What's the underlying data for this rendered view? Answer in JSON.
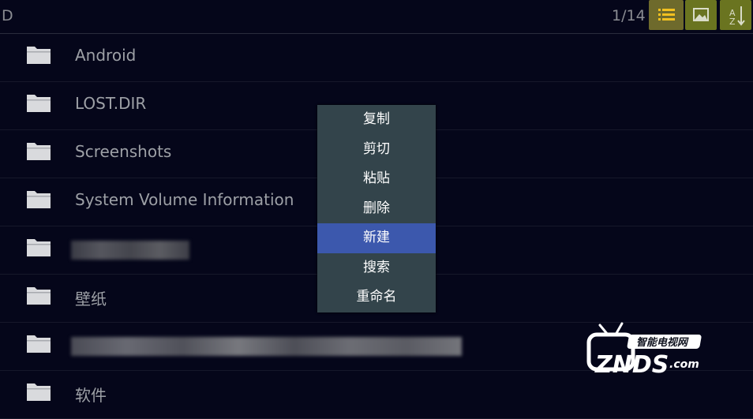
{
  "header": {
    "path": "D",
    "page_indicator": "1/14",
    "buttons": [
      {
        "name": "list-view-button",
        "icon": "list-icon",
        "color": "#6e6a2c"
      },
      {
        "name": "thumbnail-view-button",
        "icon": "image-icon",
        "color": "#6a7420"
      },
      {
        "name": "sort-button",
        "icon": "sort-icon",
        "color": "#6a7420"
      }
    ]
  },
  "files": [
    {
      "name": "Android",
      "type": "folder"
    },
    {
      "name": "LOST.DIR",
      "type": "folder"
    },
    {
      "name": "Screenshots",
      "type": "folder"
    },
    {
      "name": "System Volume Information",
      "type": "folder"
    },
    {
      "name": "",
      "type": "folder",
      "redacted": true
    },
    {
      "name": "壁纸",
      "type": "folder"
    },
    {
      "name": "",
      "type": "folder",
      "redacted": true
    },
    {
      "name": "软件",
      "type": "folder"
    }
  ],
  "context_menu": {
    "items": [
      "复制",
      "剪切",
      "粘贴",
      "删除",
      "新建",
      "搜索",
      "重命名"
    ],
    "selected": "新建",
    "bg_color": "#33444b",
    "selected_color": "#3c58ad"
  },
  "watermark": {
    "text_cn": "智能电视网",
    "text_en": "ZNDS",
    "domain": ".com"
  }
}
